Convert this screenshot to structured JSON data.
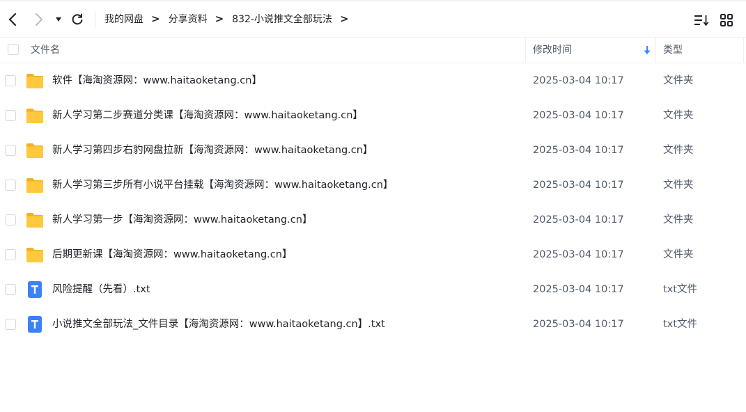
{
  "toolbar": {
    "icons": {
      "back": "chevron-left-icon",
      "forward": "chevron-right-icon",
      "dropdown": "caret-down-icon",
      "refresh": "refresh-icon",
      "sort": "sort-list-icon",
      "grid": "grid-view-icon"
    }
  },
  "breadcrumb": {
    "items": [
      "我的网盘",
      "分享资料",
      "832-小说推文全部玩法"
    ],
    "separator": ">"
  },
  "table": {
    "headers": {
      "name": "文件名",
      "modified": "修改时间",
      "type": "类型"
    },
    "sort_indicator": "down-arrow-icon",
    "rows": [
      {
        "icon": "folder-icon",
        "name": "软件【海淘资源网：www.haitaoketang.cn】",
        "modified": "2025-03-04 10:17",
        "type": "文件夹"
      },
      {
        "icon": "folder-icon",
        "name": "新人学习第二步赛道分类课【海淘资源网：www.haitaoketang.cn】",
        "modified": "2025-03-04 10:17",
        "type": "文件夹"
      },
      {
        "icon": "folder-icon",
        "name": "新人学习第四步右豹网盘拉新【海淘资源网：www.haitaoketang.cn】",
        "modified": "2025-03-04 10:17",
        "type": "文件夹"
      },
      {
        "icon": "folder-icon",
        "name": "新人学习第三步所有小说平台挂载【海淘资源网：www.haitaoketang.cn】",
        "modified": "2025-03-04 10:17",
        "type": "文件夹"
      },
      {
        "icon": "folder-icon",
        "name": "新人学习第一步【海淘资源网：www.haitaoketang.cn】",
        "modified": "2025-03-04 10:17",
        "type": "文件夹"
      },
      {
        "icon": "folder-icon",
        "name": "后期更新课【海淘资源网：www.haitaoketang.cn】",
        "modified": "2025-03-04 10:17",
        "type": "文件夹"
      },
      {
        "icon": "txt-file-icon",
        "name": "风险提醒（先看）.txt",
        "modified": "2025-03-04 10:17",
        "type": "txt文件"
      },
      {
        "icon": "txt-file-icon",
        "name": "小说推文全部玩法_文件目录【海淘资源网：www.haitaoketang.cn】.txt",
        "modified": "2025-03-04 10:17",
        "type": "txt文件"
      }
    ]
  },
  "colors": {
    "folder": "#ffc83d",
    "folder_back": "#f5b025",
    "txt_icon": "#3b82f6",
    "sort_arrow": "#2f88ff",
    "text": "#1f2329",
    "muted": "#4e5969"
  }
}
